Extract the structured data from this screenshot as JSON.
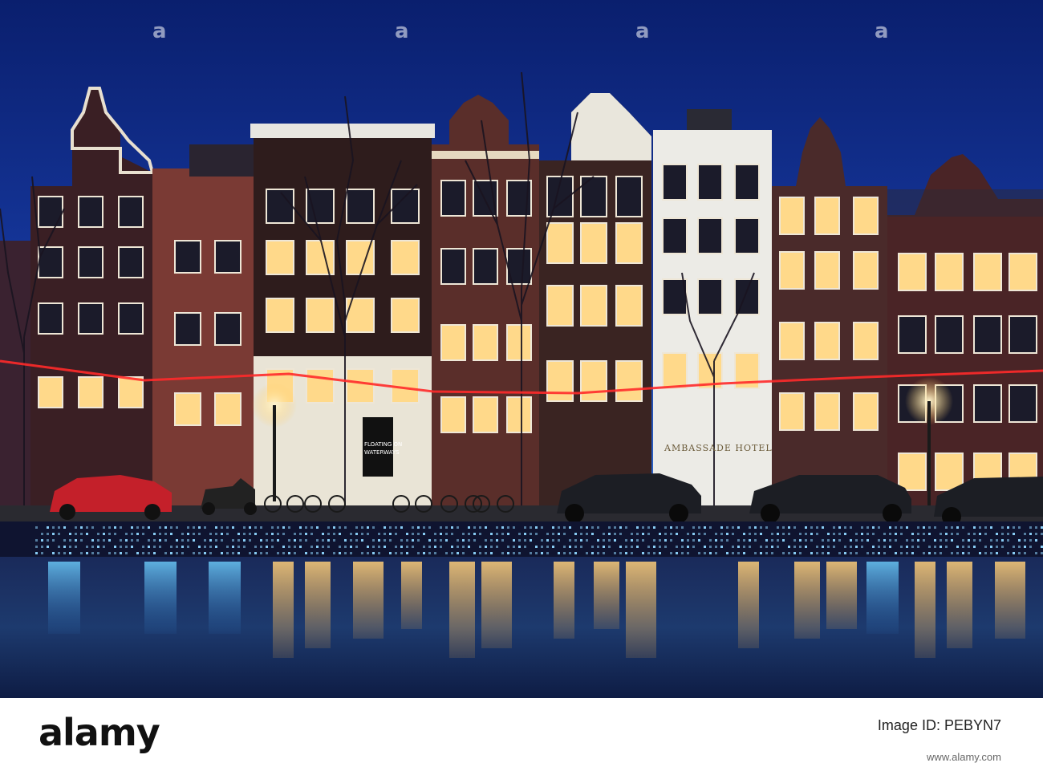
{
  "photo": {
    "subject": "canal houses at night",
    "colors": {
      "sky_top": "#0a1f6e",
      "sky_mid": "#16389e",
      "sky_horizon": "#2f6bd0",
      "window_glow": "#ffd98a",
      "string_light": "#ff2a2a",
      "quay_lights": "#8fd6ff",
      "water_reflection": "#e8a94a"
    }
  },
  "signs": {
    "board_line1": "FLOATING ON",
    "board_line2": "WATERWAYS",
    "hotel_name": "AMBASSADE HOTEL"
  },
  "watermark": {
    "glyph": "a"
  },
  "footer": {
    "logo": "alamy",
    "image_id_label": "Image ID: PEBYN7",
    "url": "www.alamy.com"
  }
}
